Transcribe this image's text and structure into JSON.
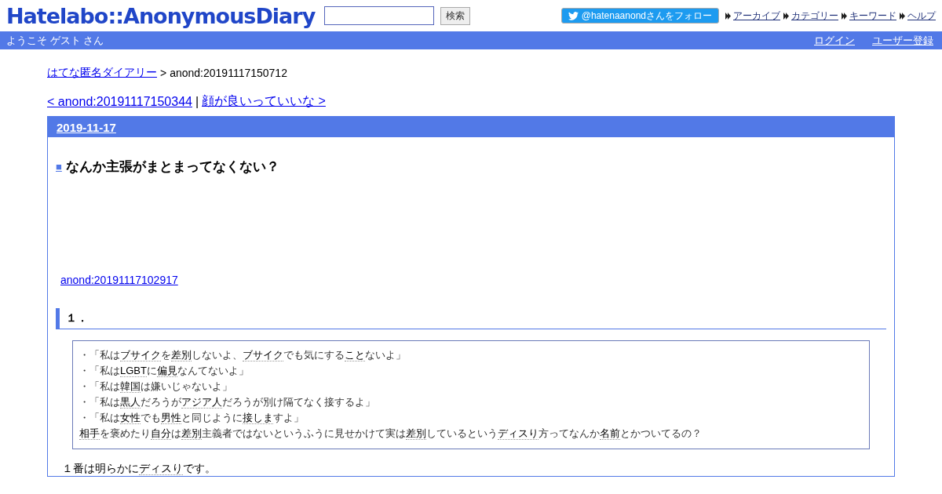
{
  "header": {
    "logo": "Hatelabo::AnonymousDiary",
    "search_button": "検索",
    "follow_button": "@hatenaanondさんをフォロー",
    "nav_links": [
      "アーカイブ",
      "カテゴリー",
      "キーワード",
      "ヘルプ"
    ]
  },
  "welcome_bar": {
    "greeting": "ようこそ ゲスト さん",
    "links": [
      "ログイン",
      "ユーザー登録"
    ]
  },
  "breadcrumb": {
    "home": "はてな匿名ダイアリー",
    "separator": ">",
    "current": "anond:20191117150712"
  },
  "pager": {
    "prev": "< anond:20191117150344",
    "separator": "|",
    "next": "顔が良いっていいな >"
  },
  "day": {
    "date": "2019-11-17",
    "title": {
      "mark": "■",
      "text": "なんか主張がまとまってなくない？"
    },
    "reference": "anond:20191117102917",
    "heading": "１．",
    "quote_lines": [
      [
        {
          "t": "・「私は"
        },
        {
          "t": "ブサイク",
          "k": true
        },
        {
          "t": "を"
        },
        {
          "t": "差別",
          "k": true
        },
        {
          "t": "しないよ、"
        },
        {
          "t": "ブサイク",
          "k": true
        },
        {
          "t": "でも気にする"
        },
        {
          "t": "こと",
          "k": true
        },
        {
          "t": "ないよ」"
        }
      ],
      [
        {
          "t": "・「私は"
        },
        {
          "t": "LGBT",
          "k": true
        },
        {
          "t": "に"
        },
        {
          "t": "偏見",
          "k": true
        },
        {
          "t": "なんてないよ」"
        }
      ],
      [
        {
          "t": "・「私は"
        },
        {
          "t": "韓国",
          "k": true
        },
        {
          "t": "は嫌いじゃないよ」"
        }
      ],
      [
        {
          "t": "・「私は"
        },
        {
          "t": "黒人",
          "k": true
        },
        {
          "t": "だろうが"
        },
        {
          "t": "アジア人",
          "k": true
        },
        {
          "t": "だろうが別け隔てなく接するよ」"
        }
      ],
      [
        {
          "t": "・「私は"
        },
        {
          "t": "女性",
          "k": true
        },
        {
          "t": "でも"
        },
        {
          "t": "男性",
          "k": true
        },
        {
          "t": "と同じように"
        },
        {
          "t": "接しま",
          "k": true
        },
        {
          "t": "すよ」"
        }
      ],
      [
        {
          "t": "相手",
          "k": true
        },
        {
          "t": "を褒めたり"
        },
        {
          "t": "自分",
          "k": true
        },
        {
          "t": "は"
        },
        {
          "t": "差別",
          "k": true
        },
        {
          "t": "主義者ではないというふうに見せかけて実は"
        },
        {
          "t": "差別",
          "k": true
        },
        {
          "t": "しているという"
        },
        {
          "t": "ディスり",
          "k": true
        },
        {
          "t": "方ってなんか"
        },
        {
          "t": "名前",
          "k": true
        },
        {
          "t": "とかついてるの？"
        }
      ]
    ],
    "paragraphs": [
      [
        {
          "t": "１番は明らかに"
        },
        {
          "t": "ディスり",
          "k": true
        },
        {
          "t": "です。"
        }
      ]
    ]
  }
}
